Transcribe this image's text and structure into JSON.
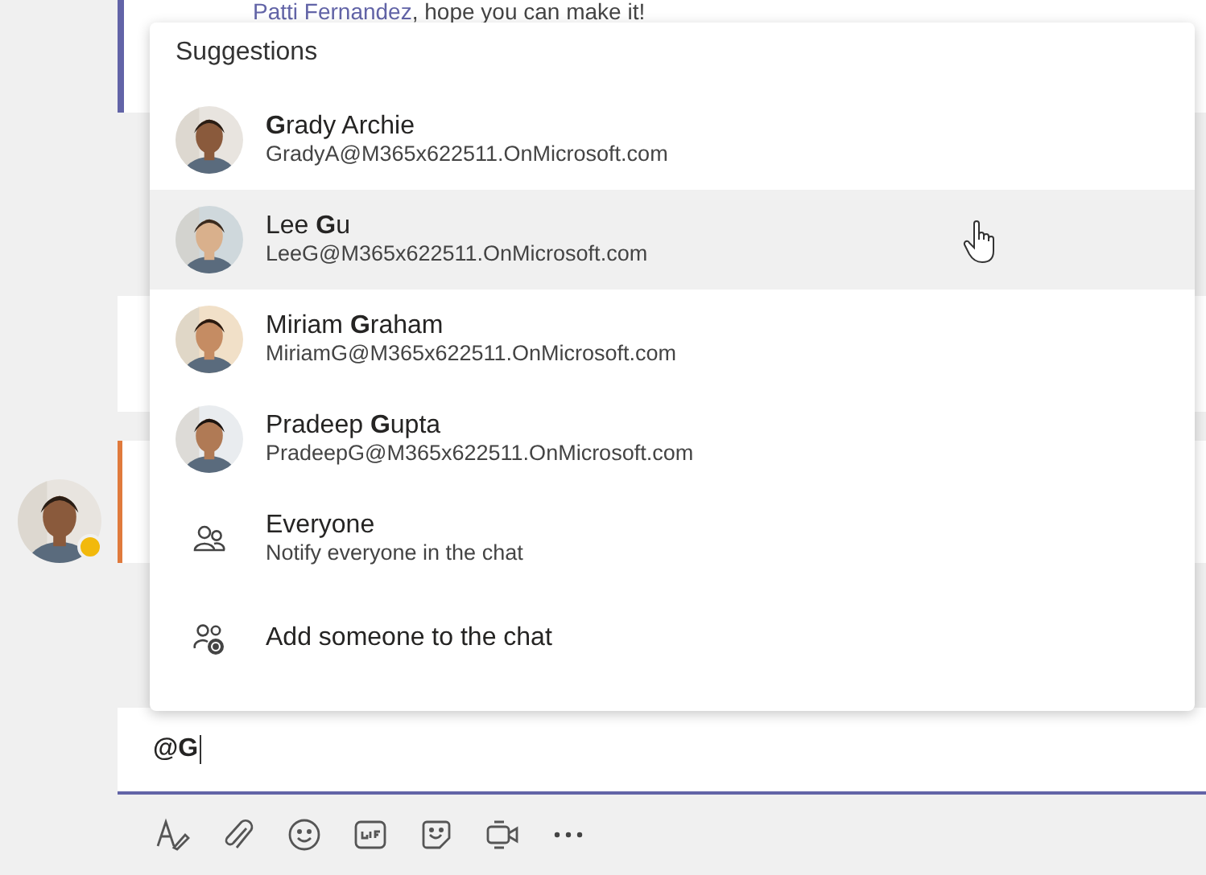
{
  "message": {
    "mention": "Patti Fernandez",
    "text": ", hope you can make it!"
  },
  "sender_status": {
    "color": "#f2b90c"
  },
  "suggestions": {
    "title": "Suggestions",
    "items": [
      {
        "kind": "person",
        "name": "**G**rady Archie",
        "email": "GradyA@M365x622511.OnMicrosoft.com",
        "selected": false
      },
      {
        "kind": "person",
        "name": "Lee **G**u",
        "email": "LeeG@M365x622511.OnMicrosoft.com",
        "selected": true
      },
      {
        "kind": "person",
        "name": "Miriam **G**raham",
        "email": "MiriamG@M365x622511.OnMicrosoft.com",
        "selected": false
      },
      {
        "kind": "person",
        "name": "Pradeep **G**upta",
        "email": "PradeepG@M365x622511.OnMicrosoft.com",
        "selected": false
      },
      {
        "kind": "everyone",
        "name": "Everyone",
        "email": "Notify everyone in the chat",
        "selected": false
      },
      {
        "kind": "add",
        "name": "Add someone to the chat",
        "selected": false
      }
    ]
  },
  "compose": {
    "value": "@G"
  }
}
